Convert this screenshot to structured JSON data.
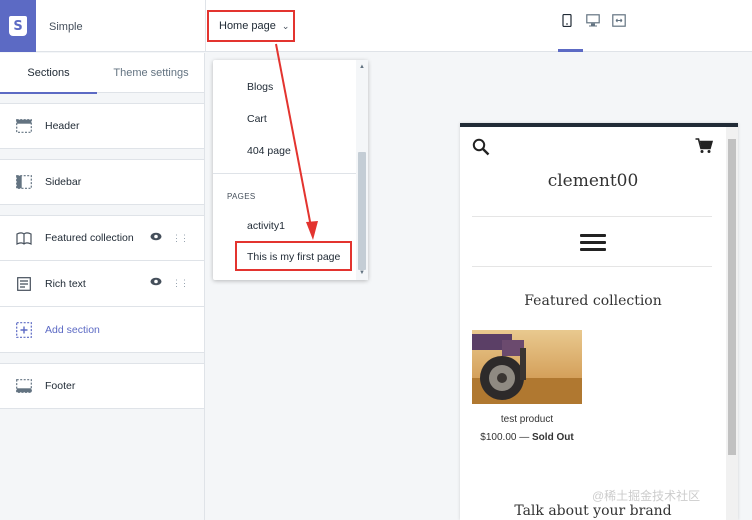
{
  "topbar": {
    "theme_name": "Simple",
    "page_selector": "Home page",
    "devices": [
      "mobile-icon",
      "desktop-icon",
      "fullscreen-icon"
    ]
  },
  "sidebar": {
    "tabs": [
      "Sections",
      "Theme settings"
    ],
    "sections": [
      {
        "label": "Header",
        "icon": "header-icon"
      },
      {
        "label": "Sidebar",
        "icon": "sidebar-icon"
      },
      {
        "label": "Featured collection",
        "icon": "book-icon"
      },
      {
        "label": "Rich text",
        "icon": "text-icon"
      },
      {
        "label": "Add section",
        "icon": "add-icon"
      },
      {
        "label": "Footer",
        "icon": "footer-icon"
      }
    ]
  },
  "dropdown": {
    "items": [
      "Blogs",
      "Cart",
      "404 page"
    ],
    "pages_heading": "PAGES",
    "pages": [
      "activity1",
      "This is my first page"
    ]
  },
  "preview": {
    "store_name": "clement00",
    "featured_heading": "Featured collection",
    "product_name": "test product",
    "price": "$100.00",
    "price_sep": " — ",
    "sold_out": "Sold Out",
    "talk_heading": "Talk about your brand"
  },
  "watermark": "@稀土掘金技术社区",
  "colors": {
    "accent": "#5c6ac4",
    "annotation": "#e3342f"
  }
}
